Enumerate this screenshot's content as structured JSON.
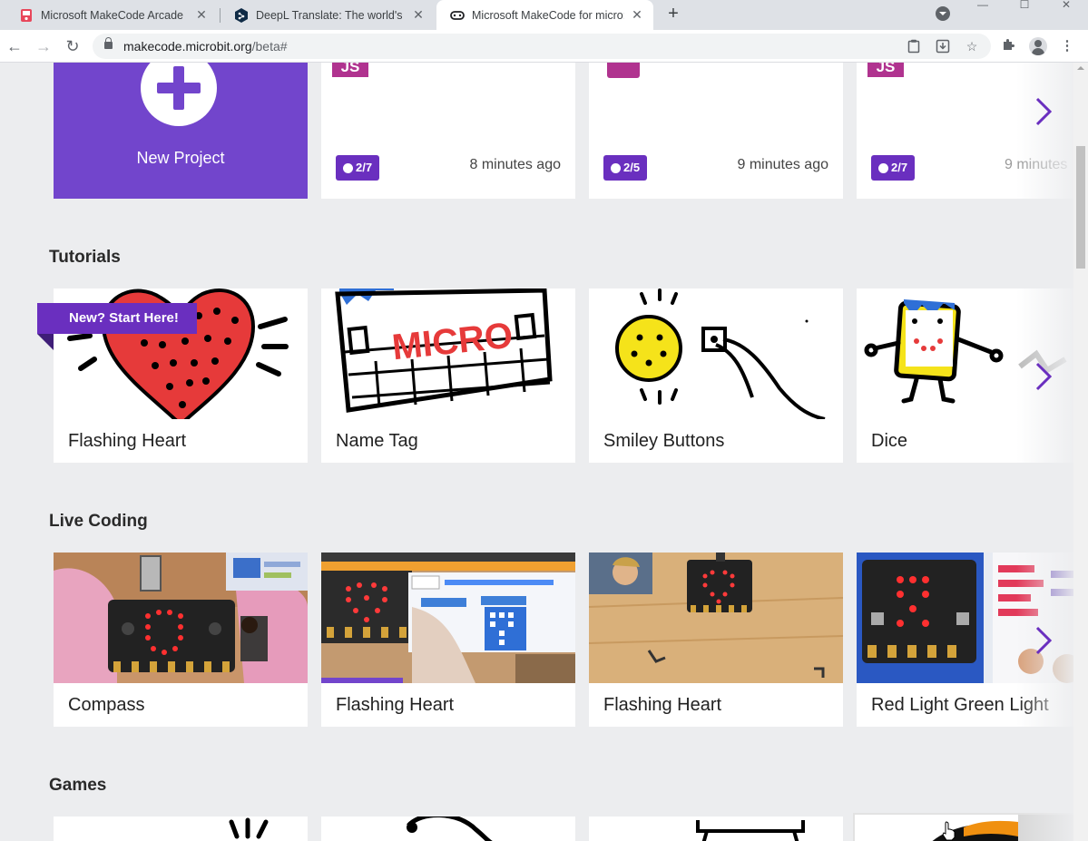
{
  "browser": {
    "tabs": [
      {
        "title": "Microsoft MakeCode Arcade",
        "icon": "makecode-arcade-icon",
        "active": false
      },
      {
        "title": "DeepL Translate: The world's most accurate translator",
        "icon": "deepl-icon",
        "active": false
      },
      {
        "title": "Microsoft MakeCode for micro:bit",
        "icon": "microbit-icon",
        "active": true
      }
    ],
    "new_tab_label": "+",
    "url_host": "makecode.microbit.org",
    "url_path": "/beta#"
  },
  "projects": {
    "new_project_label": "New Project",
    "items": [
      {
        "badge": "2/7",
        "time": "8 minutes ago",
        "logo": "JS"
      },
      {
        "badge": "2/5",
        "time": "9 minutes ago",
        "logo": ""
      },
      {
        "badge": "2/7",
        "time": "9 minutes",
        "logo": "JS"
      }
    ]
  },
  "tutorials": {
    "title": "Tutorials",
    "ribbon": "New? Start Here!",
    "items": [
      {
        "name": "Flashing Heart"
      },
      {
        "name": "Name Tag"
      },
      {
        "name": "Smiley Buttons"
      },
      {
        "name": "Dice"
      }
    ]
  },
  "live_coding": {
    "title": "Live Coding",
    "items": [
      {
        "name": "Compass"
      },
      {
        "name": "Flashing Heart"
      },
      {
        "name": "Flashing Heart"
      },
      {
        "name": "Red Light Green Light"
      }
    ]
  },
  "games": {
    "title": "Games"
  },
  "name_tag_text": "MICRO",
  "colors": {
    "purple": "#7245cc",
    "badge_purple": "#6a2fbf",
    "js_pink": "#b0338f",
    "page_bg": "#ecedef"
  }
}
